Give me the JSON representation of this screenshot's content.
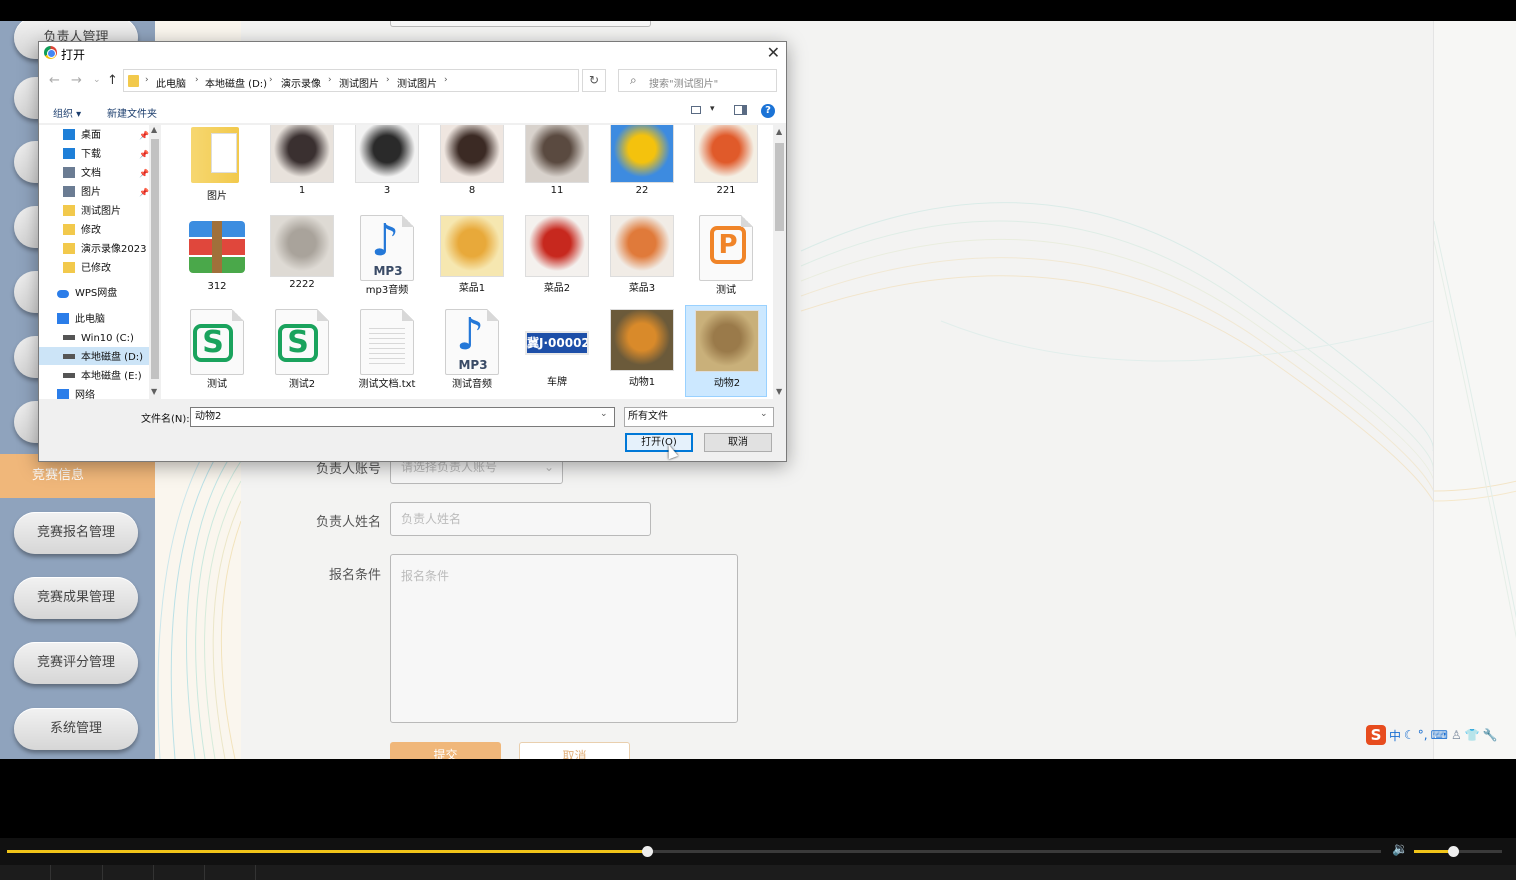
{
  "app": {
    "sidebar_items": [
      {
        "label": "负责人管理"
      },
      {
        "label": "竞赛信息"
      },
      {
        "label": "竞赛报名管理"
      },
      {
        "label": "竞赛成果管理"
      },
      {
        "label": "竞赛评分管理"
      },
      {
        "label": "系统管理"
      }
    ],
    "form": {
      "account_label": "负责人账号",
      "account_placeholder": "请选择负责人账号",
      "name_label": "负责人姓名",
      "name_placeholder": "负责人姓名",
      "condition_label": "报名条件",
      "condition_placeholder": "报名条件",
      "submit_label": "提交",
      "cancel_label": "取消"
    },
    "ime": {
      "lang": "中"
    }
  },
  "dialog": {
    "title": "打开",
    "breadcrumb": [
      "此电脑",
      "本地磁盘 (D:)",
      "演示录像",
      "测试图片",
      "测试图片"
    ],
    "search_placeholder": "搜索\"测试图片\"",
    "toolbar": {
      "organize": "组织 ▾",
      "new_folder": "新建文件夹"
    },
    "nav_items": [
      {
        "label": "桌面",
        "icon": "desktop-icon",
        "color": "#1e7fd8",
        "pinned": true
      },
      {
        "label": "下载",
        "icon": "download-icon",
        "color": "#1e7fd8",
        "pinned": true
      },
      {
        "label": "文档",
        "icon": "document-icon",
        "color": "#6b7c93",
        "pinned": true
      },
      {
        "label": "图片",
        "icon": "pictures-icon",
        "color": "#6b7c93",
        "pinned": true
      },
      {
        "label": "测试图片",
        "icon": "folder-icon",
        "color": "#f2c94c",
        "pinned": false
      },
      {
        "label": "修改",
        "icon": "folder-icon",
        "color": "#f2c94c",
        "pinned": false
      },
      {
        "label": "演示录像2023",
        "icon": "folder-icon",
        "color": "#f2c94c",
        "pinned": false
      },
      {
        "label": "已修改",
        "icon": "folder-icon",
        "color": "#f2c94c",
        "pinned": false
      },
      {
        "label": "WPS网盘",
        "icon": "cloud-icon",
        "color": "#2b7de9",
        "pinned": false
      },
      {
        "label": "此电脑",
        "icon": "computer-icon",
        "color": "#2b7de9",
        "pinned": false
      },
      {
        "label": "Win10 (C:)",
        "icon": "drive-icon",
        "color": "#555555",
        "pinned": false
      },
      {
        "label": "本地磁盘 (D:)",
        "icon": "drive-icon",
        "color": "#555555",
        "pinned": false
      },
      {
        "label": "本地磁盘 (E:)",
        "icon": "drive-icon",
        "color": "#555555",
        "pinned": false
      },
      {
        "label": "网络",
        "icon": "network-icon",
        "color": "#2b7de9",
        "pinned": false
      }
    ],
    "files": [
      {
        "name": "图片",
        "kind": "folder"
      },
      {
        "name": "1",
        "kind": "photo",
        "colors": [
          "#e8e2dc",
          "#3a3030"
        ]
      },
      {
        "name": "3",
        "kind": "photo",
        "colors": [
          "#f2f2f2",
          "#2a2a2a"
        ]
      },
      {
        "name": "8",
        "kind": "photo",
        "colors": [
          "#efe6e0",
          "#3b2a24"
        ]
      },
      {
        "name": "11",
        "kind": "photo",
        "colors": [
          "#d8d2cc",
          "#5a4a40"
        ]
      },
      {
        "name": "22",
        "kind": "photo",
        "colors": [
          "#3d8be0",
          "#f4c20d"
        ]
      },
      {
        "name": "221",
        "kind": "photo",
        "colors": [
          "#f4efe4",
          "#e05a2a"
        ]
      },
      {
        "name": "312",
        "kind": "winrar"
      },
      {
        "name": "2222",
        "kind": "photo",
        "colors": [
          "#dedad4",
          "#a9a39b"
        ]
      },
      {
        "name": "mp3音频",
        "kind": "mp3"
      },
      {
        "name": "菜品1",
        "kind": "photo",
        "colors": [
          "#f6e7b0",
          "#e8a93a"
        ]
      },
      {
        "name": "菜品2",
        "kind": "photo",
        "colors": [
          "#f4f1ee",
          "#c7281e"
        ]
      },
      {
        "name": "菜品3",
        "kind": "photo",
        "colors": [
          "#f1ece6",
          "#e07a3a"
        ]
      },
      {
        "name": "测试",
        "kind": "wps-p"
      },
      {
        "name": "测试",
        "kind": "wps-s"
      },
      {
        "name": "测试2",
        "kind": "wps-s"
      },
      {
        "name": "测试文档.txt",
        "kind": "txt"
      },
      {
        "name": "测试音频",
        "kind": "mp3"
      },
      {
        "name": "车牌",
        "kind": "plate",
        "plate_text": "冀J·00002"
      },
      {
        "name": "动物1",
        "kind": "photo",
        "colors": [
          "#6b5a3a",
          "#d98a2a"
        ]
      },
      {
        "name": "动物2",
        "kind": "photo",
        "colors": [
          "#c9b07a",
          "#9a7a4a"
        ],
        "selected": true
      }
    ],
    "mp3_label": "MP3",
    "filename_label": "文件名(N):",
    "filename_value": "动物2",
    "filetype_value": "所有文件",
    "open_label": "打开(O)",
    "cancel_label": "取消"
  },
  "player": {
    "progress": 0.466,
    "volume": 0.44,
    "accent": "#f0c419"
  }
}
